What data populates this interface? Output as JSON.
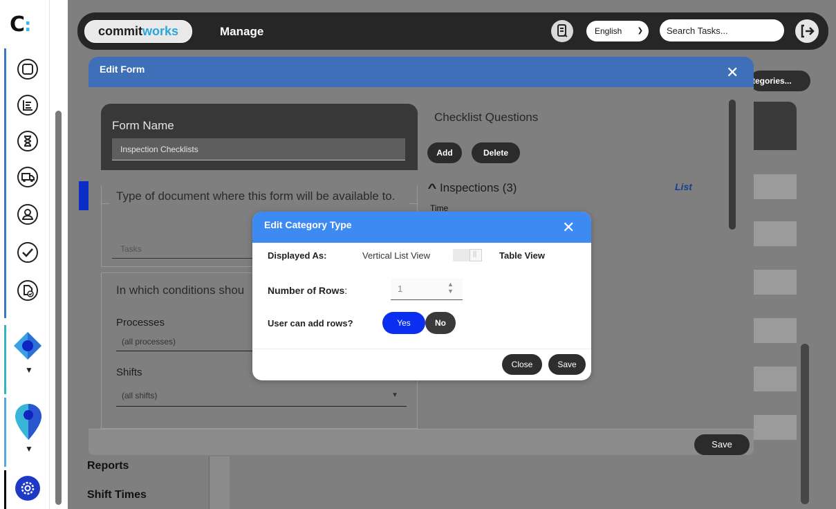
{
  "app": {
    "logo_letter": "C",
    "logo_dots": ":",
    "brand_commit": "commit",
    "brand_works": "works",
    "section_title": "Manage",
    "language": "English",
    "search_placeholder": "Search Tasks..."
  },
  "sidebar": {
    "icons": [
      "square-icon",
      "list-icon",
      "hourglass-icon",
      "truck-icon",
      "user-icon",
      "check-icon",
      "badge-check-icon"
    ],
    "caret": "▼",
    "settings_icon": "gear-icon"
  },
  "background_page": {
    "categories_button": "tegories...",
    "links": [
      "Reports",
      "Shift Times"
    ]
  },
  "edit_form": {
    "title": "Edit Form",
    "close": "✕",
    "form_name_label": "Form Name",
    "form_name_value": "Inspection Checklists",
    "document_type_label": "Type of document where this form will be available to.",
    "document_type_value": "Tasks",
    "conditions_label": "In which conditions shou",
    "processes_label": "Processes",
    "processes_value": "(all processes)",
    "shifts_label": "Shifts",
    "shifts_value": "(all shifts)",
    "checklist_title": "Checklist Questions",
    "add_button": "Add",
    "delete_button": "Delete",
    "inspections_label": "Inspections (3)",
    "inspections_caret": "^",
    "list_link": "List",
    "time_label": "Time",
    "save_button": "Save"
  },
  "category_dialog": {
    "title": "Edit Category Type",
    "close": "✕",
    "displayed_as_label": "Displayed As:",
    "vertical_option": "Vertical List View",
    "table_option": "Table View",
    "rows_label": "Number of Rows",
    "rows_colon": ":",
    "rows_value": "1",
    "add_rows_label": "User can add rows?",
    "yes": "Yes",
    "no": "No",
    "close_button": "Close",
    "save_button": "Save"
  },
  "colors": {
    "accent_blue": "#3d8bf2",
    "form_header": "#3f6fb8",
    "yes_blue": "#0b2ff0",
    "dark_button": "#2e2e2e"
  }
}
